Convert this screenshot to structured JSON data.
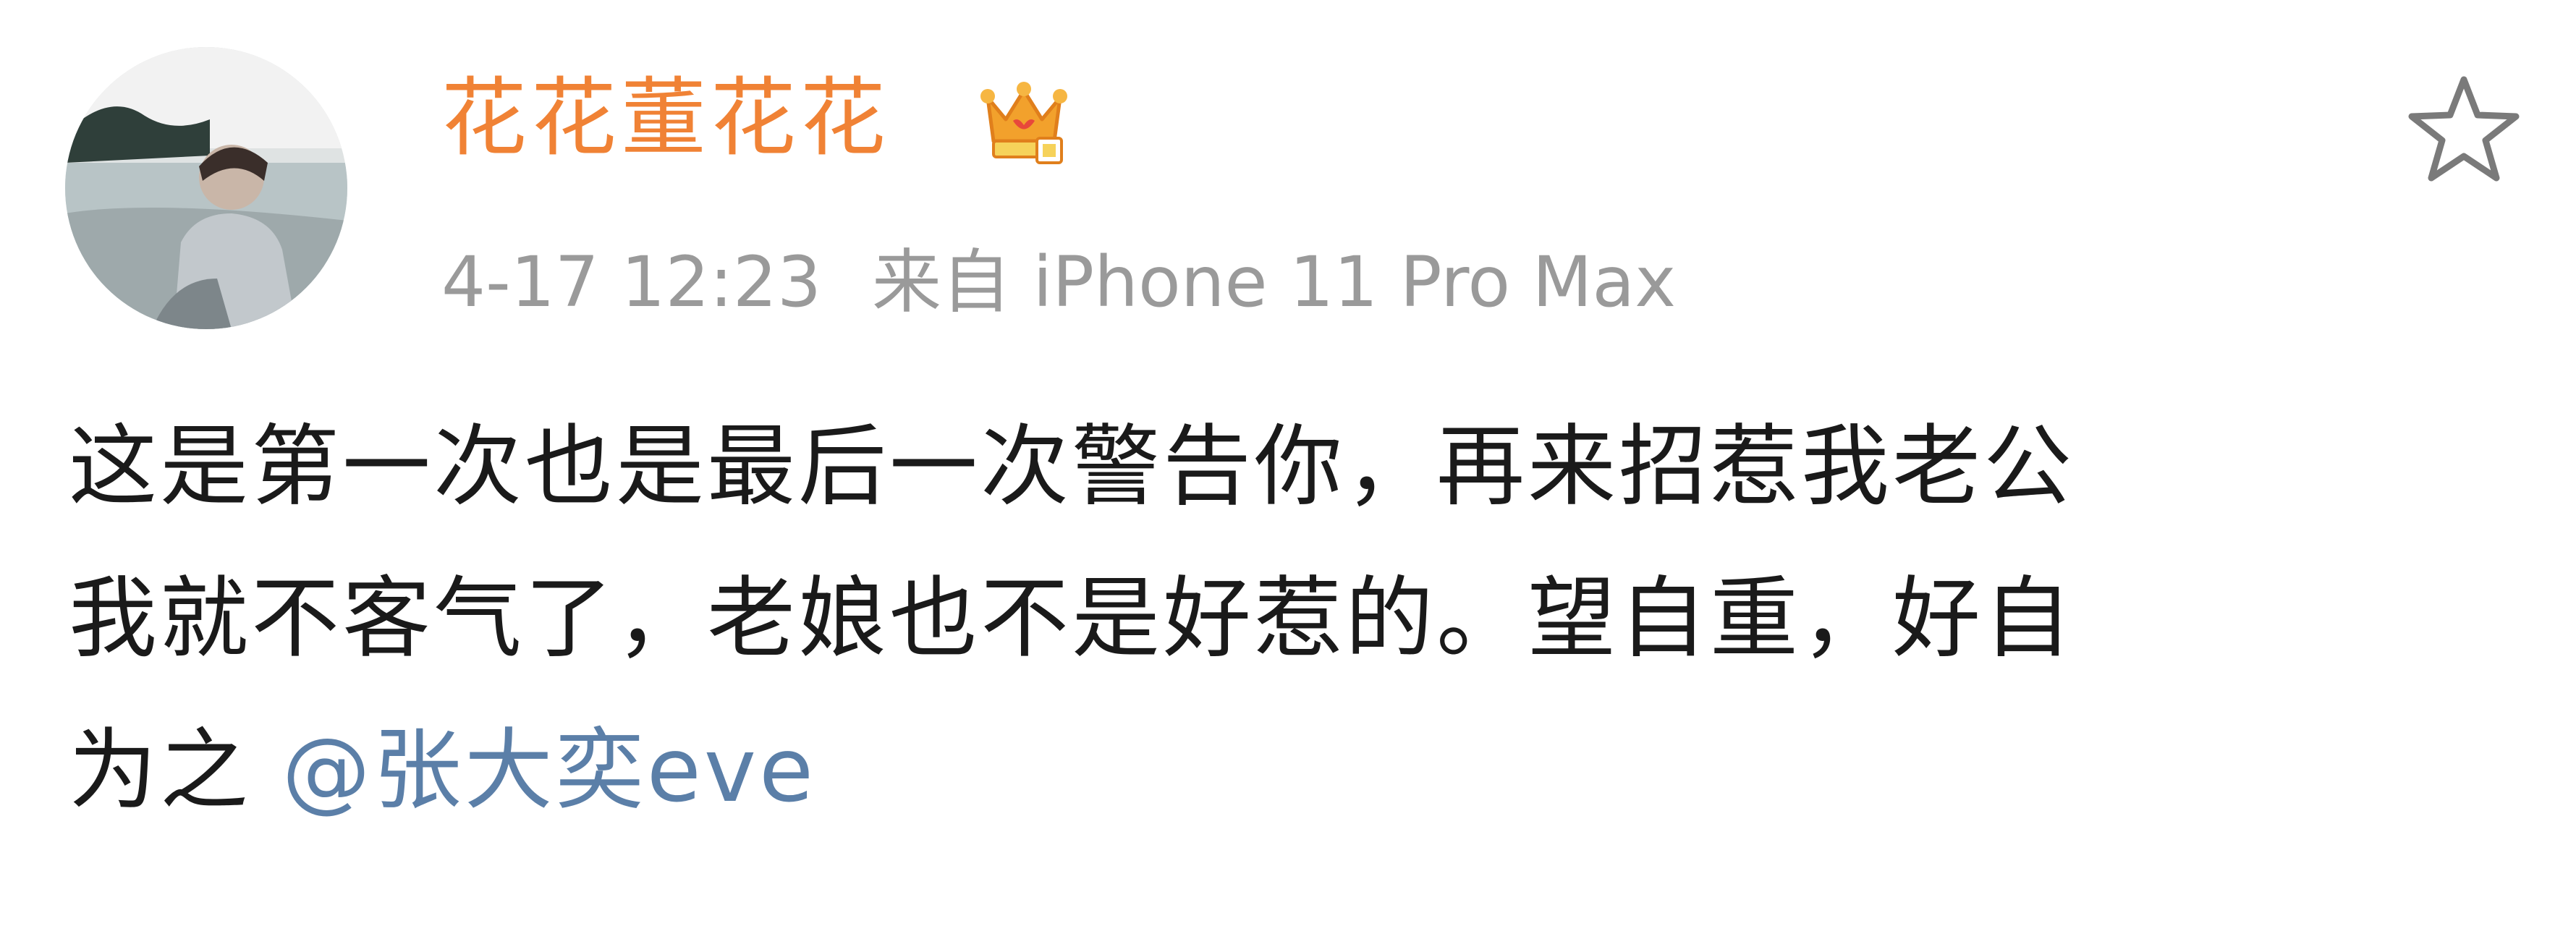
{
  "post": {
    "author": {
      "name": "花花董花花",
      "avatar_icon": "avatar-photo",
      "badge_icon": "vip-crown-badge-icon",
      "name_color": "#f08235"
    },
    "meta": {
      "time": "4-17 12:23",
      "source": "来自 iPhone 11 Pro Max"
    },
    "favorite_icon": "star-icon",
    "content": {
      "lines": [
        "这是第一次也是最后一次警告你，再来招惹我老公",
        "我就不客气了，老娘也不是好惹的。望自重，好自",
        "为之 "
      ],
      "mention": "@张大奕eve",
      "mention_color": "#5b7fa8"
    }
  }
}
